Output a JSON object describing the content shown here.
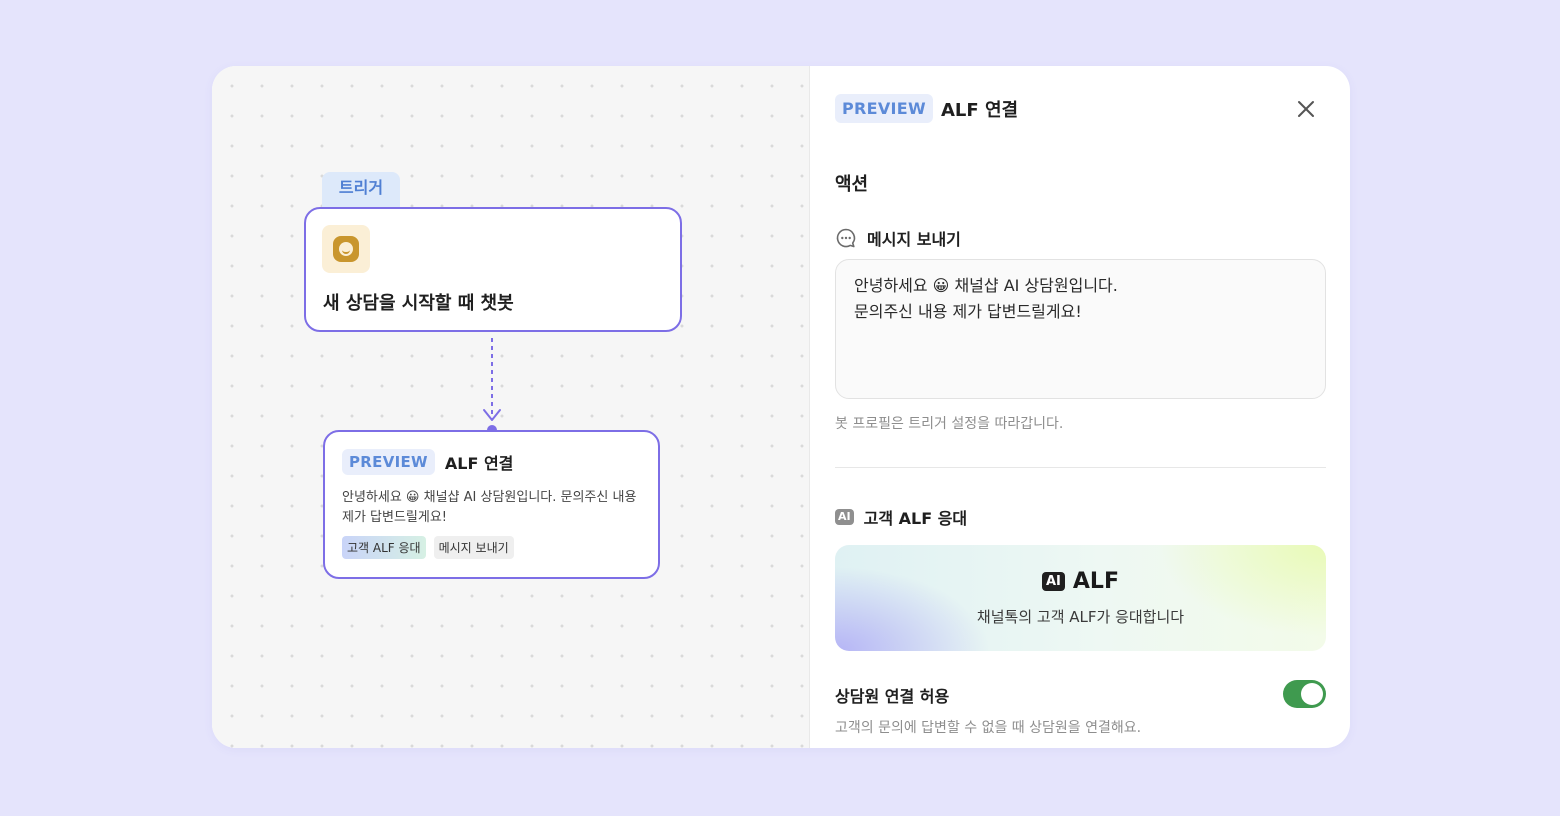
{
  "canvas": {
    "trigger": {
      "tag": "트리거",
      "title": "새 상담을 시작할 때 챗봇",
      "icon": "chatbot-face-icon"
    },
    "alf_node": {
      "badge": "PREVIEW",
      "title": "ALF 연결",
      "message": "안녕하세요 😀 채널샵 AI 상담원입니다. 문의주신 내용 제가 답변드릴게요!",
      "chips": [
        "고객 ALF 응대",
        "메시지 보내기"
      ]
    }
  },
  "panel": {
    "badge": "PREVIEW",
    "title": "ALF 연결",
    "close_icon": "close-icon",
    "section_title": "액션",
    "message_section": {
      "label": "메시지 보내기",
      "icon": "chat-bubble-icon",
      "text_line1": "안녕하세요 😀 채널샵 AI 상담원입니다.",
      "text_line2": "문의주신 내용 제가 답변드릴게요!",
      "hint": "봇 프로필은 트리거 설정을 따라갑니다."
    },
    "alf_section": {
      "label": "고객 ALF 응대",
      "icon_text": "AI",
      "banner_badge": "AI",
      "banner_title": "ALF",
      "banner_desc": "채널톡의 고객 ALF가 응대합니다"
    },
    "agent_connect": {
      "label": "상담원 연결 허용",
      "hint": "고객의 문의에 답변할 수 없을 때 상담원을 연결해요.",
      "enabled": true
    }
  },
  "colors": {
    "background": "#e5e4fc",
    "node_border": "#7d6ee6",
    "preview_badge": "#5c8ad8",
    "toggle_on": "#3f9a4f"
  }
}
